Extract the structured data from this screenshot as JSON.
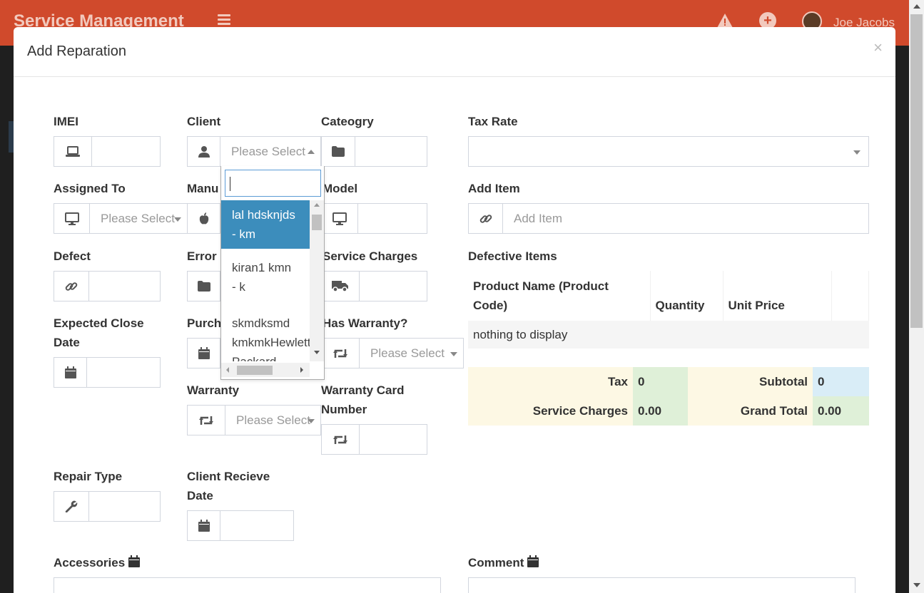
{
  "app": {
    "title": "Service Management",
    "user_name": "Joe Jacobs"
  },
  "modal": {
    "title": "Add Reparation",
    "close": "×"
  },
  "labels": {
    "imei": "IMEI",
    "client": "Client",
    "category": "Category",
    "tax_rate": "Tax Rate",
    "assigned_to": "Assigned To",
    "manufacturer": "Manu",
    "model": "Model",
    "add_item": "Add Item",
    "defect": "Defect",
    "error": "Error",
    "service_charges": "Service Charges",
    "defective_items": "Defective Items",
    "expected_close_line1": "Expected Close",
    "expected_close_line2": "Date",
    "purchase": "Purch",
    "has_warranty": "Has Warranty?",
    "warranty": "Warranty",
    "warranty_card_line1": "Warranty Card",
    "warranty_card_line2": "Number",
    "repair_type": "Repair Type",
    "client_receive_line1": "Client Recieve",
    "client_receive_line2": "Date",
    "accessories": "Accessories",
    "comment": "Comment"
  },
  "fields": {
    "client_select": "Please Select",
    "assigned_to_select": "Please Select",
    "has_warranty_select": "Please Select",
    "warranty_select": "Please Select",
    "add_item_placeholder": "Add Item"
  },
  "defective_items": {
    "headers": [
      "Product Name (Product Code)",
      "Quantity",
      "Unit Price",
      ""
    ],
    "empty": "nothing to display"
  },
  "totals": {
    "tax_label": "Tax",
    "tax_value": "0",
    "subtotal_label": "Subtotal",
    "subtotal_value": "0",
    "service_charges_label": "Service Charges",
    "service_charges_value": "0.00",
    "grand_total_label": "Grand Total",
    "grand_total_value": "0.00"
  },
  "client_dropdown": {
    "search_value": "",
    "options": [
      {
        "line1": "lal hdsknjds",
        "line2": "- km",
        "selected": true
      },
      {
        "line1": "kiran1 kmn",
        "line2": "- k",
        "selected": false
      },
      {
        "line1": "skmdksmd",
        "line2": "kmkmkHewlett",
        "line3": "Packard -",
        "selected": false
      }
    ]
  },
  "colors": {
    "appbar": "#d04a2c",
    "selected_option": "#3c8dbc"
  }
}
